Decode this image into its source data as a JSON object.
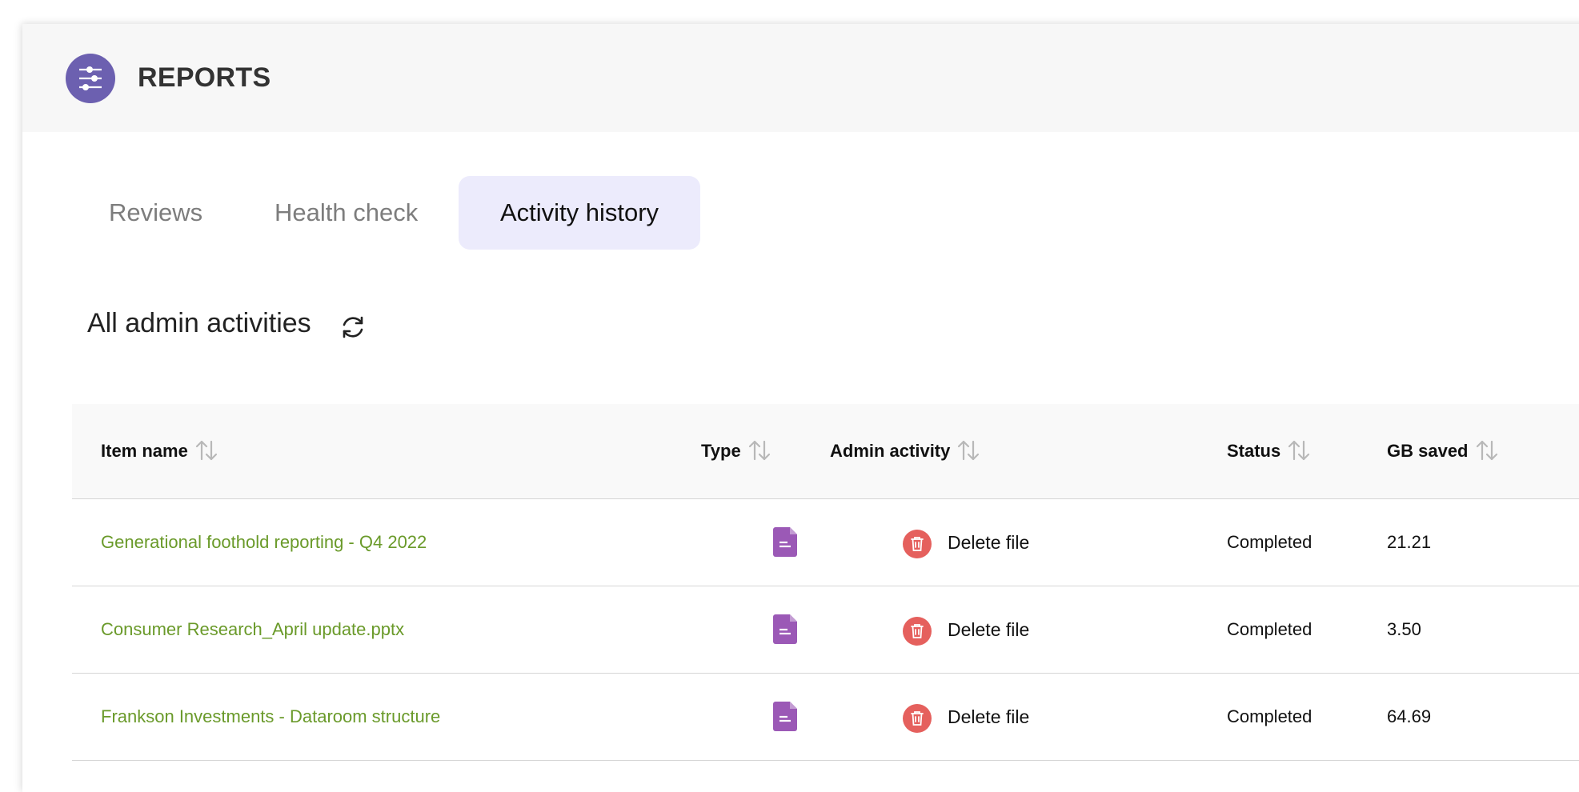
{
  "app": {
    "title": "REPORTS",
    "logo_icon": "sliders-icon",
    "accent_color": "#6c60b0"
  },
  "tabs": [
    {
      "label": "Reviews",
      "active": false
    },
    {
      "label": "Health check",
      "active": false
    },
    {
      "label": "Activity history",
      "active": true
    }
  ],
  "section": {
    "title": "All admin activities",
    "refresh_icon": "refresh-icon"
  },
  "table": {
    "columns": [
      {
        "label": "Item name",
        "sortable": true
      },
      {
        "label": "Type",
        "sortable": true
      },
      {
        "label": "Admin activity",
        "sortable": true
      },
      {
        "label": "Status",
        "sortable": true
      },
      {
        "label": "GB saved",
        "sortable": true
      }
    ],
    "rows": [
      {
        "item_name": "Generational foothold reporting - Q4 2022",
        "type_icon": "document-icon",
        "activity_icon": "trash-icon",
        "activity": "Delete file",
        "status": "Completed",
        "gb_saved": "21.21"
      },
      {
        "item_name": "Consumer Research_April update.pptx",
        "type_icon": "document-icon",
        "activity_icon": "trash-icon",
        "activity": "Delete file",
        "status": "Completed",
        "gb_saved": "3.50"
      },
      {
        "item_name": "Frankson Investments - Dataroom structure",
        "type_icon": "document-icon",
        "activity_icon": "trash-icon",
        "activity": "Delete file",
        "status": "Completed",
        "gb_saved": "64.69"
      }
    ]
  },
  "colors": {
    "link": "#6a9a2a",
    "doc_icon": "#9b59b6",
    "delete_icon": "#e5605d",
    "active_tab_bg": "#ecebfc"
  }
}
